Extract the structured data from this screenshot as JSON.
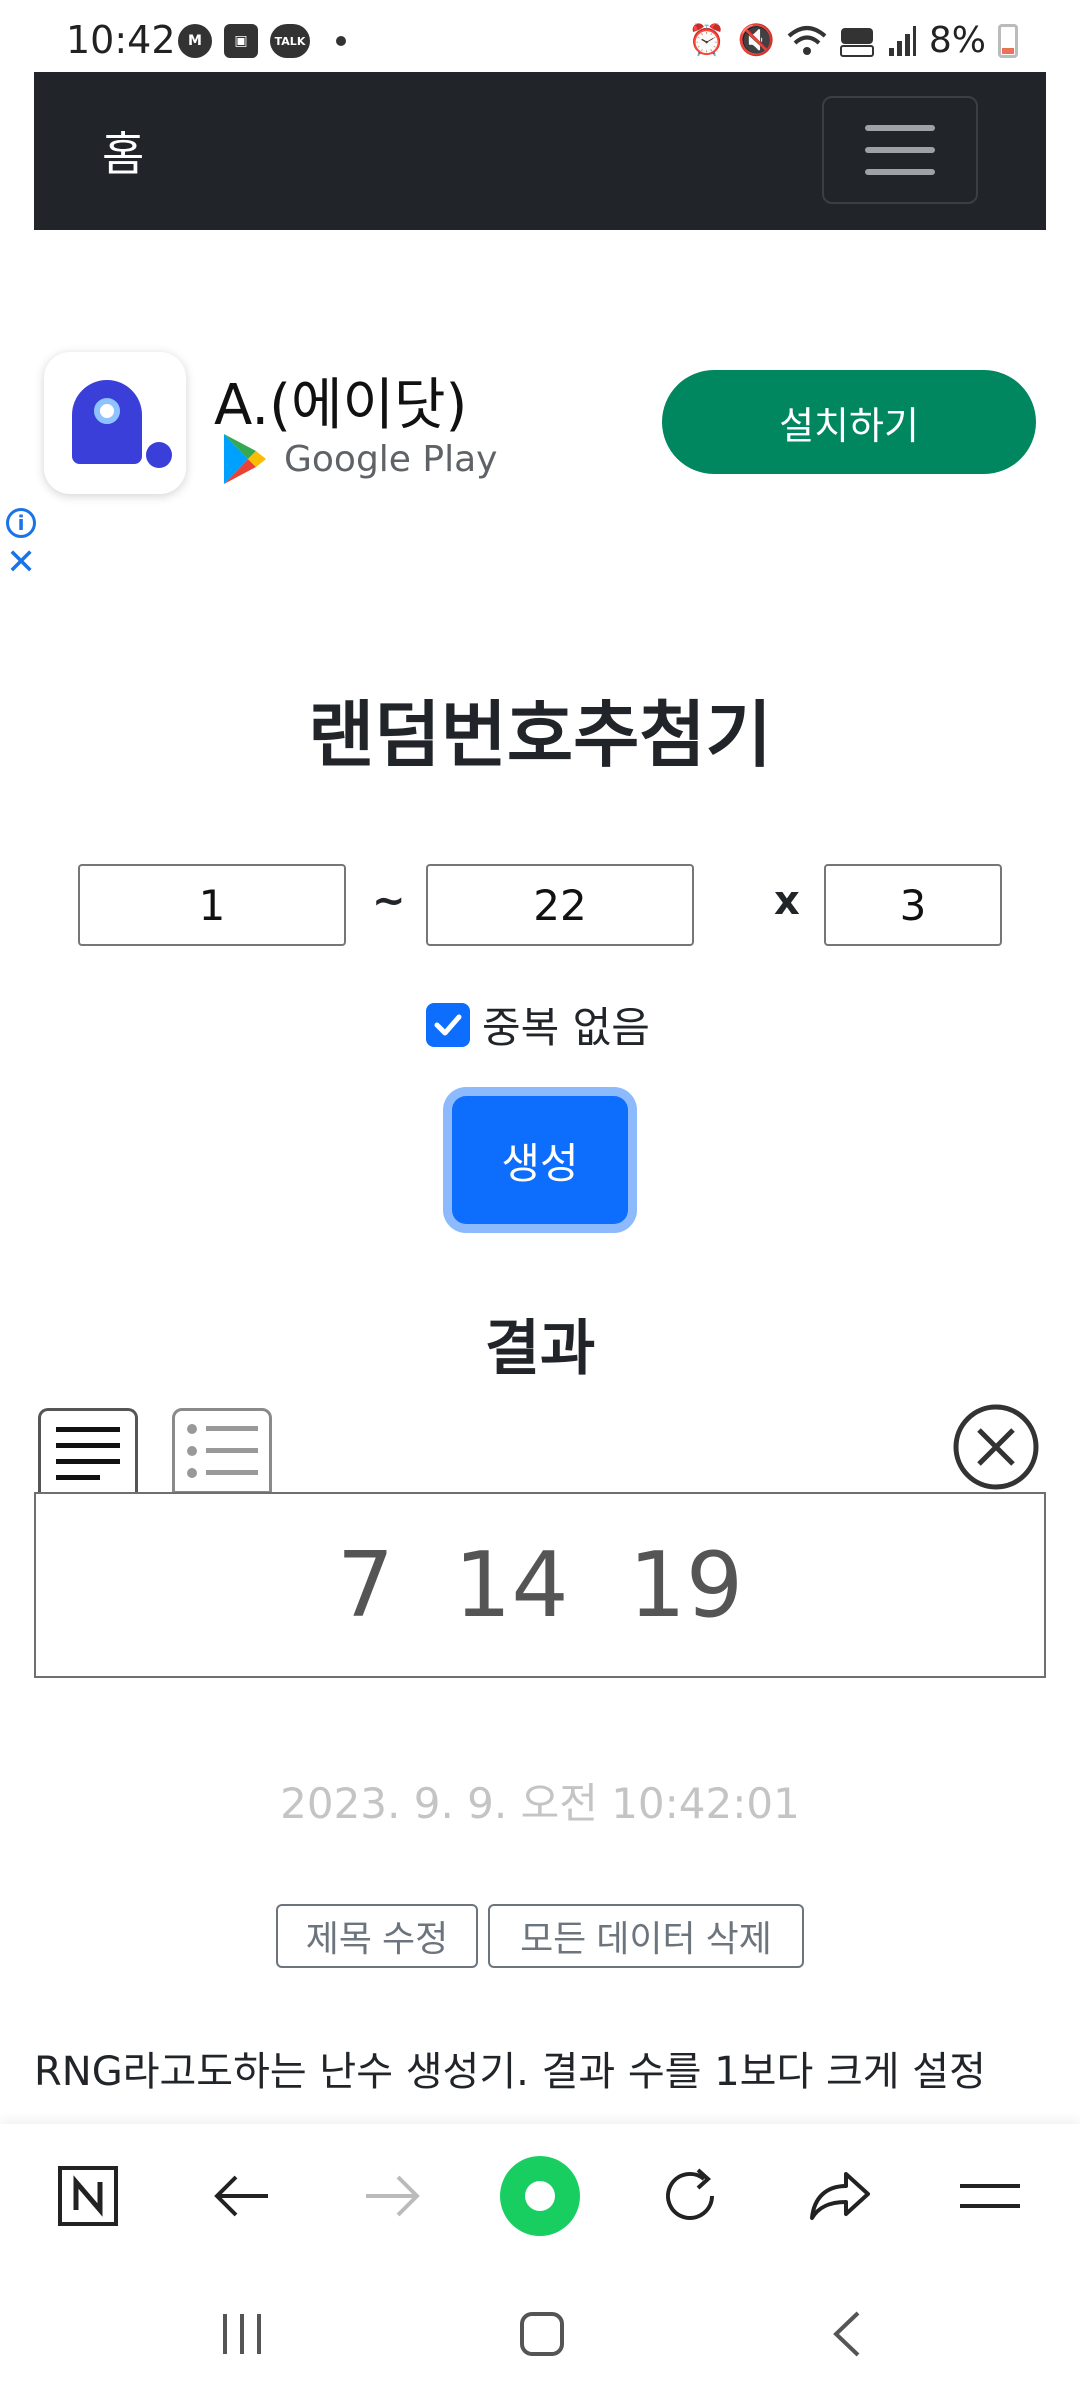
{
  "status_bar": {
    "time": "10:42",
    "left_icons": [
      "messenger-icon",
      "gallery-icon",
      "kakaotalk-icon",
      "notification-dot-icon"
    ],
    "talk_badge": "TALK",
    "right_icons": [
      "alarm-icon",
      "mute-icon",
      "wifi-icon",
      "hd-voice-icon",
      "signal-icon"
    ],
    "battery": "8%"
  },
  "navbar": {
    "brand": "홈",
    "toggle_icon": "hamburger-icon",
    "bg_color": "#212529"
  },
  "ad": {
    "app_name": "A.(에이닷)",
    "store": "Google Play",
    "install_label": "설치하기",
    "install_color": "#01875f"
  },
  "main": {
    "title": "랜덤번호추첨기",
    "range_min": "1",
    "range_sep": "~",
    "range_max": "22",
    "count_sep": "x",
    "count": "3",
    "no_duplicate_label": "중복 없음",
    "no_duplicate_checked": true,
    "generate_label": "생성",
    "accent_color": "#0d6efd"
  },
  "result": {
    "heading": "결과",
    "numbers": [
      "7",
      "14",
      "19"
    ],
    "timestamp": "2023. 9. 9. 오전 10:42:01",
    "edit_title_label": "제목 수정",
    "delete_all_label": "모든 데이터 삭제"
  },
  "description": "RNG라고도하는 난수 생성기. 결과 수를 1보다 크게 설정",
  "browser_bar": {
    "items": [
      "naver-home-icon",
      "back-arrow-icon",
      "forward-arrow-icon",
      "green-dot-icon",
      "reload-icon",
      "share-icon",
      "menu-icon"
    ]
  },
  "system_nav": {
    "items": [
      "recent-apps-icon",
      "home-icon",
      "back-icon"
    ]
  }
}
